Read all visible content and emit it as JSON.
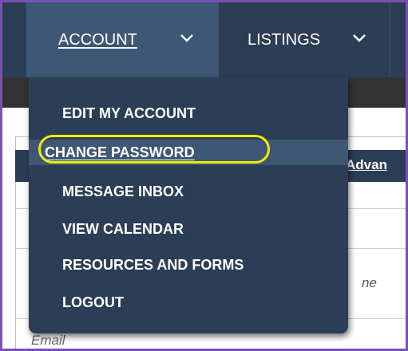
{
  "nav": {
    "account_label": "ACCOUNT",
    "listings_label": "LISTINGS"
  },
  "menu": {
    "items": [
      {
        "label": "EDIT MY ACCOUNT"
      },
      {
        "label": "CHANGE PASSWORD",
        "active": true
      },
      {
        "label": "MESSAGE INBOX"
      },
      {
        "label": "VIEW CALENDAR"
      },
      {
        "label": "RESOURCES AND FORMS"
      },
      {
        "label": "LOGOUT"
      }
    ]
  },
  "background": {
    "advanced_link": "Advan",
    "name_field_fragment": "ne",
    "email_placeholder": "Email"
  },
  "colors": {
    "nav_bg": "#2c3e55",
    "nav_active_bg": "#3d5775",
    "highlight": "#f2ea00",
    "frame_border": "#7a4fb5"
  },
  "icons": {
    "account_dropdown": "chevron-down-icon",
    "listings_dropdown": "chevron-down-icon"
  }
}
